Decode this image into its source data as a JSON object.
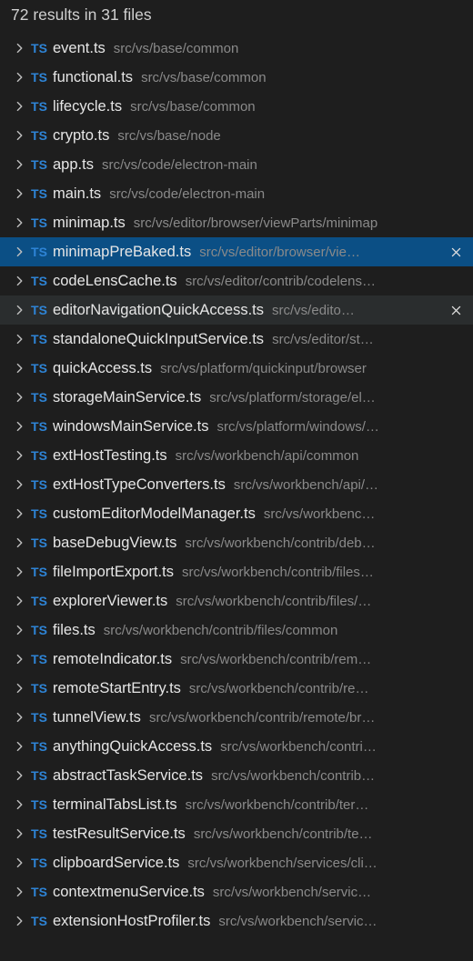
{
  "header": {
    "summary": "72 results in 31 files"
  },
  "icons": {
    "ts_badge": "TS"
  },
  "colors": {
    "background": "#1e1e1e",
    "selected": "#0b4f85",
    "hover": "#2a2d2e",
    "ts": "#2e84d6",
    "path": "#8a8a8a",
    "file": "#e6e6e6"
  },
  "rows": [
    {
      "file": "event.ts",
      "path": "src/vs/base/common",
      "selected": false,
      "hovered": false,
      "showClose": false
    },
    {
      "file": "functional.ts",
      "path": "src/vs/base/common",
      "selected": false,
      "hovered": false,
      "showClose": false
    },
    {
      "file": "lifecycle.ts",
      "path": "src/vs/base/common",
      "selected": false,
      "hovered": false,
      "showClose": false
    },
    {
      "file": "crypto.ts",
      "path": "src/vs/base/node",
      "selected": false,
      "hovered": false,
      "showClose": false
    },
    {
      "file": "app.ts",
      "path": "src/vs/code/electron-main",
      "selected": false,
      "hovered": false,
      "showClose": false
    },
    {
      "file": "main.ts",
      "path": "src/vs/code/electron-main",
      "selected": false,
      "hovered": false,
      "showClose": false
    },
    {
      "file": "minimap.ts",
      "path": "src/vs/editor/browser/viewParts/minimap",
      "selected": false,
      "hovered": false,
      "showClose": false
    },
    {
      "file": "minimapPreBaked.ts",
      "path": "src/vs/editor/browser/vie…",
      "selected": true,
      "hovered": false,
      "showClose": true
    },
    {
      "file": "codeLensCache.ts",
      "path": "src/vs/editor/contrib/codelens…",
      "selected": false,
      "hovered": false,
      "showClose": false
    },
    {
      "file": "editorNavigationQuickAccess.ts",
      "path": "src/vs/edito…",
      "selected": false,
      "hovered": true,
      "showClose": true
    },
    {
      "file": "standaloneQuickInputService.ts",
      "path": "src/vs/editor/st…",
      "selected": false,
      "hovered": false,
      "showClose": false
    },
    {
      "file": "quickAccess.ts",
      "path": "src/vs/platform/quickinput/browser",
      "selected": false,
      "hovered": false,
      "showClose": false
    },
    {
      "file": "storageMainService.ts",
      "path": "src/vs/platform/storage/el…",
      "selected": false,
      "hovered": false,
      "showClose": false
    },
    {
      "file": "windowsMainService.ts",
      "path": "src/vs/platform/windows/…",
      "selected": false,
      "hovered": false,
      "showClose": false
    },
    {
      "file": "extHostTesting.ts",
      "path": "src/vs/workbench/api/common",
      "selected": false,
      "hovered": false,
      "showClose": false
    },
    {
      "file": "extHostTypeConverters.ts",
      "path": "src/vs/workbench/api/…",
      "selected": false,
      "hovered": false,
      "showClose": false
    },
    {
      "file": "customEditorModelManager.ts",
      "path": "src/vs/workbenc…",
      "selected": false,
      "hovered": false,
      "showClose": false
    },
    {
      "file": "baseDebugView.ts",
      "path": "src/vs/workbench/contrib/deb…",
      "selected": false,
      "hovered": false,
      "showClose": false
    },
    {
      "file": "fileImportExport.ts",
      "path": "src/vs/workbench/contrib/files…",
      "selected": false,
      "hovered": false,
      "showClose": false
    },
    {
      "file": "explorerViewer.ts",
      "path": "src/vs/workbench/contrib/files/…",
      "selected": false,
      "hovered": false,
      "showClose": false
    },
    {
      "file": "files.ts",
      "path": "src/vs/workbench/contrib/files/common",
      "selected": false,
      "hovered": false,
      "showClose": false
    },
    {
      "file": "remoteIndicator.ts",
      "path": "src/vs/workbench/contrib/rem…",
      "selected": false,
      "hovered": false,
      "showClose": false
    },
    {
      "file": "remoteStartEntry.ts",
      "path": "src/vs/workbench/contrib/re…",
      "selected": false,
      "hovered": false,
      "showClose": false
    },
    {
      "file": "tunnelView.ts",
      "path": "src/vs/workbench/contrib/remote/br…",
      "selected": false,
      "hovered": false,
      "showClose": false
    },
    {
      "file": "anythingQuickAccess.ts",
      "path": "src/vs/workbench/contri…",
      "selected": false,
      "hovered": false,
      "showClose": false
    },
    {
      "file": "abstractTaskService.ts",
      "path": "src/vs/workbench/contrib…",
      "selected": false,
      "hovered": false,
      "showClose": false
    },
    {
      "file": "terminalTabsList.ts",
      "path": "src/vs/workbench/contrib/ter…",
      "selected": false,
      "hovered": false,
      "showClose": false
    },
    {
      "file": "testResultService.ts",
      "path": "src/vs/workbench/contrib/te…",
      "selected": false,
      "hovered": false,
      "showClose": false
    },
    {
      "file": "clipboardService.ts",
      "path": "src/vs/workbench/services/cli…",
      "selected": false,
      "hovered": false,
      "showClose": false
    },
    {
      "file": "contextmenuService.ts",
      "path": "src/vs/workbench/servic…",
      "selected": false,
      "hovered": false,
      "showClose": false
    },
    {
      "file": "extensionHostProfiler.ts",
      "path": "src/vs/workbench/servic…",
      "selected": false,
      "hovered": false,
      "showClose": false
    }
  ]
}
